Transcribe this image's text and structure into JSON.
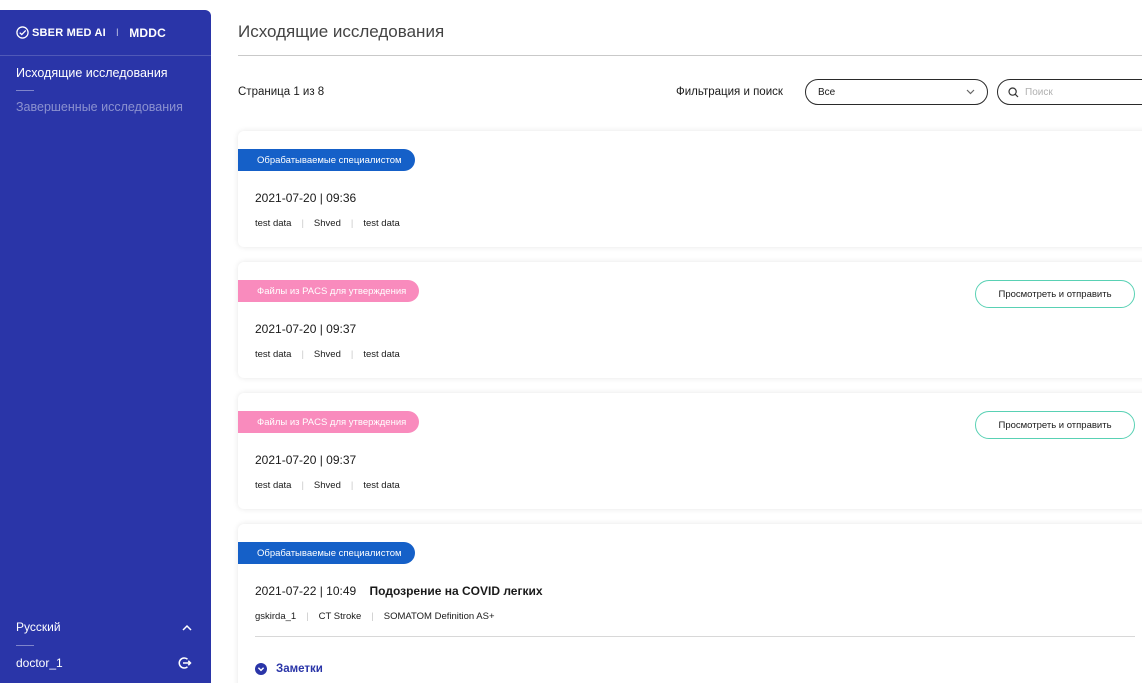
{
  "sidebar": {
    "brand_name": "SBER MED AI",
    "brand_separator": "I",
    "product": "MDDC",
    "nav": [
      {
        "label": "Исходящие исследования",
        "active": true
      },
      {
        "label": "Завершенные исследования",
        "active": false
      }
    ],
    "language": "Русский",
    "user": "doctor_1"
  },
  "header": {
    "title": "Исходящие исследования"
  },
  "toolbar": {
    "pager": "Страница 1 из 8",
    "filter_label": "Фильтрация и поиск",
    "filter_value": "Все",
    "search_placeholder": "Поиск"
  },
  "cards": [
    {
      "status": "Обрабатываемые специалистом",
      "datetime": "2021-07-20 | 09:36",
      "meta": [
        "test data",
        "Shved",
        "test data"
      ]
    },
    {
      "status": "Файлы из PACS для утверждения",
      "datetime": "2021-07-20 | 09:37",
      "meta": [
        "test data",
        "Shved",
        "test data"
      ],
      "action": "Просмотреть и отправить"
    },
    {
      "status": "Файлы из PACS для утверждения",
      "datetime": "2021-07-20 | 09:37",
      "meta": [
        "test data",
        "Shved",
        "test data"
      ],
      "action": "Просмотреть и отправить"
    },
    {
      "status": "Обрабатываемые специалистом",
      "datetime": "2021-07-22 | 10:49",
      "diagnosis": "Подозрение на COVID легких",
      "meta": [
        "gskirda_1",
        "CT Stroke",
        "SOMATOM Definition AS+"
      ],
      "notes_label": "Заметки"
    }
  ],
  "colors": {
    "sidebar_bg": "#2a35a8",
    "badge_processing": "#1560c8",
    "badge_pacs": "#f98bbd",
    "action_border": "#59d1b4"
  }
}
